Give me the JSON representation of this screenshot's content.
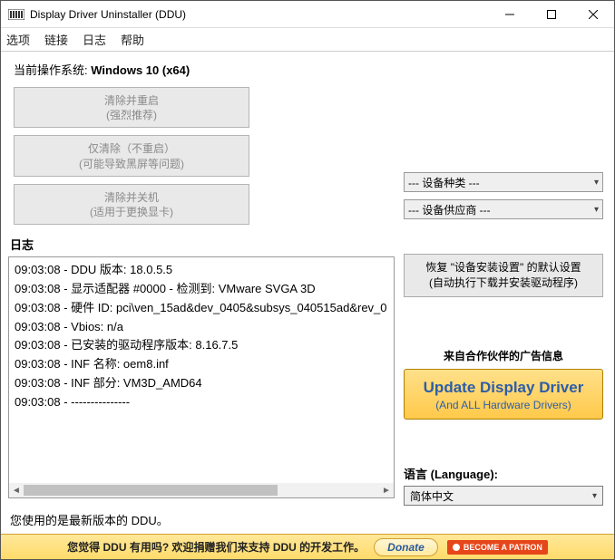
{
  "titlebar": {
    "title": "Display Driver Uninstaller (DDU)"
  },
  "menu": {
    "options": "选项",
    "links": "链接",
    "logs": "日志",
    "help": "帮助"
  },
  "os": {
    "label": "当前操作系统:",
    "value": "Windows 10 (x64)"
  },
  "buttons": {
    "clean_restart_l1": "清除并重启",
    "clean_restart_l2": "(强烈推荐)",
    "clean_only_l1": "仅清除（不重启）",
    "clean_only_l2": "(可能导致黑屏等问题)",
    "clean_shutdown_l1": "清除并关机",
    "clean_shutdown_l2": "(适用于更换显卡)"
  },
  "log": {
    "label": "日志",
    "lines": [
      "09:03:08 - DDU 版本: 18.0.5.5",
      "09:03:08 - 显示适配器 #0000 - 检测到: VMware SVGA 3D",
      "09:03:08 - 硬件 ID: pci\\ven_15ad&dev_0405&subsys_040515ad&rev_0",
      "09:03:08 - Vbios: n/a",
      "09:03:08 - 已安装的驱动程序版本: 8.16.7.5",
      "09:03:08 - INF 名称: oem8.inf",
      "09:03:08 - INF 部分: VM3D_AMD64",
      "09:03:08 - ---------------"
    ]
  },
  "right": {
    "device_type": "--- 设备种类 ---",
    "vendor": "--- 设备供应商 ---",
    "restore_l1": "恢复 \"设备安装设置\" 的默认设置",
    "restore_l2": "(自动执行下载并安装驱动程序)",
    "ad_label": "来自合作伙伴的广告信息",
    "update_l1": "Update Display Driver",
    "update_l2": "(And ALL Hardware Drivers)",
    "lang_label": "语言 (Language):",
    "lang_value": "简体中文"
  },
  "status": "您使用的是最新版本的 DDU。",
  "footer": {
    "text": "您觉得 DDU 有用吗? 欢迎捐赠我们来支持 DDU 的开发工作。",
    "donate": "Donate",
    "patron": "BECOME A PATRON"
  }
}
